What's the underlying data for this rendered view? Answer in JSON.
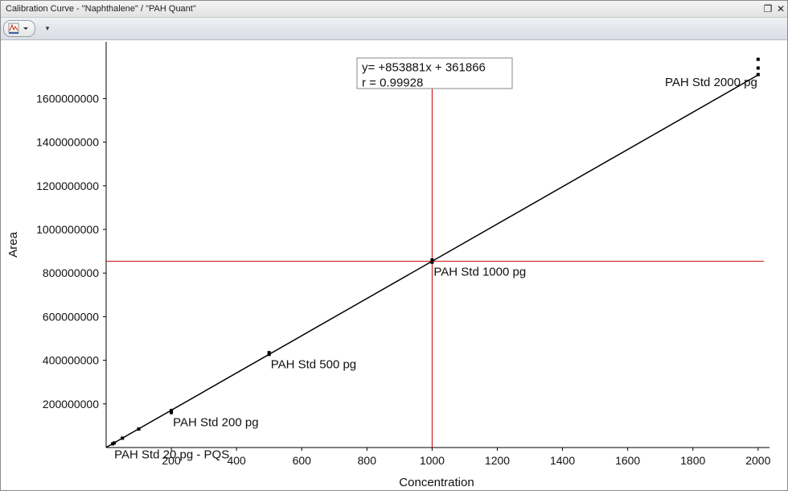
{
  "window": {
    "title": "Calibration Curve - \"Naphthalene\" / \"PAH Quant\"",
    "restore_icon": "restore-icon",
    "close_icon": "close-icon"
  },
  "toolbar": {
    "chart_menu_icon": "chart-peak-icon",
    "dropdown_icon": "chevron-down-icon",
    "customize_icon": "toolbar-overflow-icon"
  },
  "colors": {
    "fit_line": "#000000",
    "crosshair": "#cc0000",
    "points": "#000000"
  },
  "chart_data": {
    "type": "scatter",
    "xlabel": "Concentration",
    "ylabel": "Area",
    "xlim": [
      0,
      2035
    ],
    "ylim": [
      0,
      1860000000
    ],
    "x_ticks": [
      200,
      400,
      600,
      800,
      1000,
      1200,
      1400,
      1600,
      1800,
      2000
    ],
    "y_ticks": [
      200000000,
      400000000,
      600000000,
      800000000,
      1000000000,
      1200000000,
      1400000000,
      1600000000
    ],
    "grid": false,
    "fit": {
      "equation": "y=  +853881x + 361866",
      "r": "r = 0.99928",
      "slope": 853881,
      "intercept": 361866
    },
    "crosshair": {
      "x": 1000,
      "y": 854000000
    },
    "points": [
      {
        "x": 20,
        "y": 17000000
      },
      {
        "x": 25,
        "y": 21000000
      },
      {
        "x": 50,
        "y": 43000000
      },
      {
        "x": 100,
        "y": 85000000
      },
      {
        "x": 200,
        "y": 170000000
      },
      {
        "x": 200,
        "y": 160000000
      },
      {
        "x": 500,
        "y": 435000000
      },
      {
        "x": 500,
        "y": 427000000
      },
      {
        "x": 1000,
        "y": 860000000
      },
      {
        "x": 1000,
        "y": 850000000
      },
      {
        "x": 2000,
        "y": 1780000000
      },
      {
        "x": 2000,
        "y": 1740000000
      },
      {
        "x": 2000,
        "y": 1710000000
      }
    ],
    "annotations": [
      {
        "label": "PAH Std 20 pg - PQS",
        "x": 20,
        "y": 17000000
      },
      {
        "label": "PAH Std 200 pg",
        "x": 200,
        "y": 165000000
      },
      {
        "label": "PAH Std 500 pg",
        "x": 500,
        "y": 430000000
      },
      {
        "label": "PAH Std 1000 pg",
        "x": 1000,
        "y": 854000000
      },
      {
        "label": "PAH Std 2000 pg",
        "x": 2000,
        "y": 1740000000
      }
    ]
  }
}
